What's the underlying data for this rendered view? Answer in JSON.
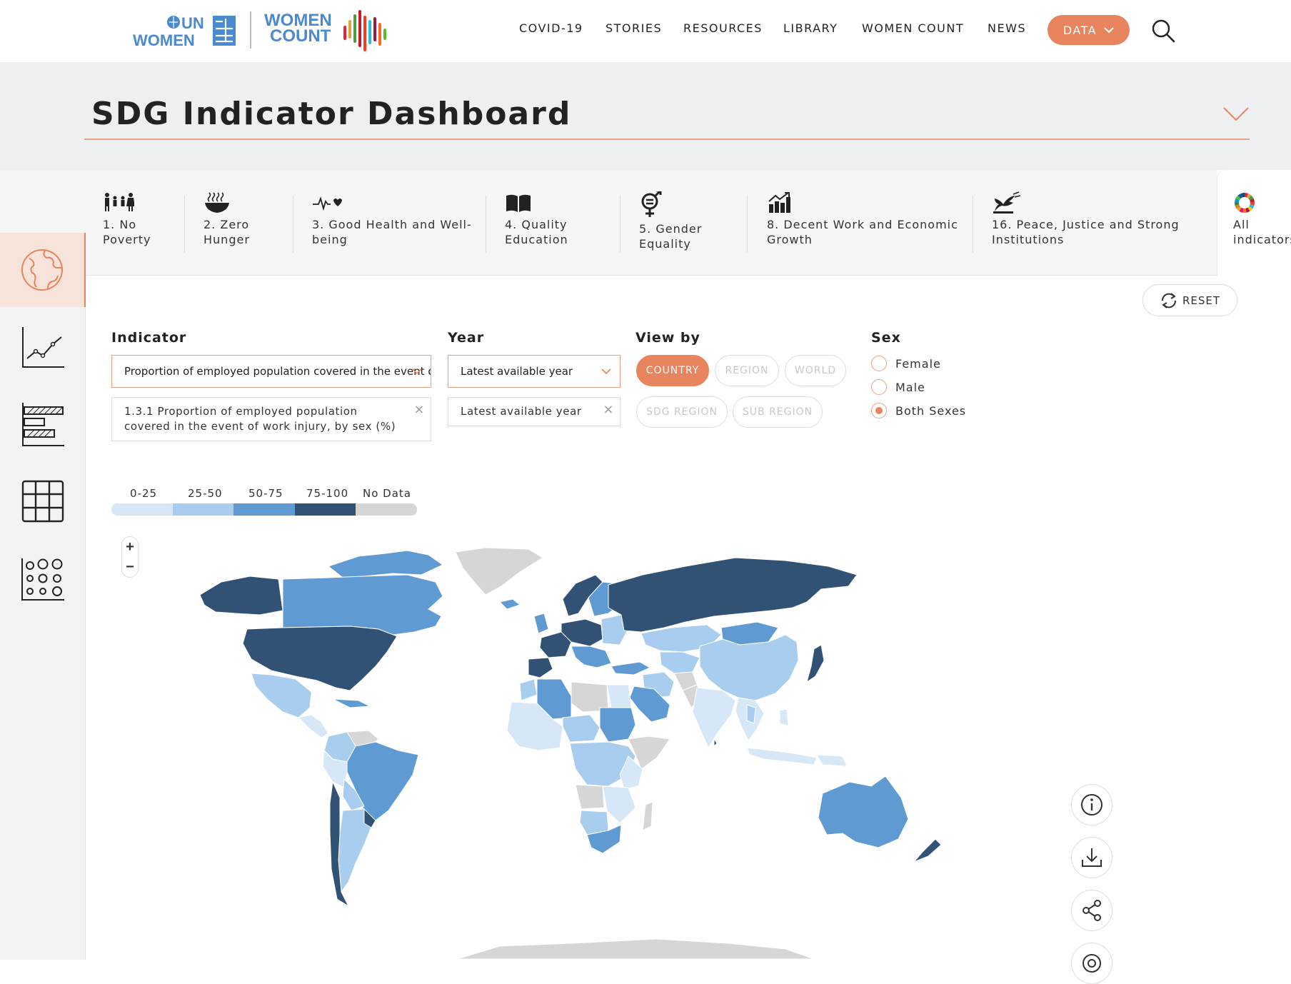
{
  "header": {
    "logo1_text": "UN WOMEN",
    "logo2_text": "WOMEN COUNT",
    "nav": [
      "COVID-19",
      "STORIES",
      "RESOURCES",
      "LIBRARY",
      "WOMEN COUNT",
      "NEWS"
    ],
    "data_button": "DATA"
  },
  "page_title": "SDG Indicator Dashboard",
  "goals": [
    {
      "line1": "1. No",
      "line2": "Poverty",
      "icon": "family-icon"
    },
    {
      "line1": "2. Zero",
      "line2": "Hunger",
      "icon": "bowl-icon"
    },
    {
      "line1": "3. Good Health and Well-",
      "line2": "being",
      "icon": "heartbeat-icon"
    },
    {
      "line1": "4. Quality",
      "line2": "Education",
      "icon": "book-icon"
    },
    {
      "line1": "5. Gender",
      "line2": "Equality",
      "icon": "gender-icon"
    },
    {
      "line1": "8. Decent Work and Economic",
      "line2": "Growth",
      "icon": "growth-chart-icon"
    },
    {
      "line1": "16. Peace, Justice and Strong",
      "line2": "Institutions",
      "icon": "dove-icon"
    }
  ],
  "all_indicators": {
    "line1": "All",
    "line2": "indicators"
  },
  "sidebar": [
    "map-view",
    "line-chart-view",
    "bar-chart-view",
    "table-view",
    "dot-grid-view"
  ],
  "reset_label": "RESET",
  "filters": {
    "indicator_label": "Indicator",
    "indicator_value": "Proportion of employed population covered in the event of work injury, by sex (%)",
    "indicator_tag_line1": "1.3.1 Proportion of employed population",
    "indicator_tag_line2": "covered in the event of work injury, by sex (%)",
    "year_label": "Year",
    "year_value": "Latest available year",
    "year_tag": "Latest available year",
    "viewby_label": "View by",
    "viewby_options": [
      "COUNTRY",
      "REGION",
      "WORLD",
      "SDG REGION",
      "SUB REGION"
    ],
    "viewby_selected": "COUNTRY",
    "sex_label": "Sex",
    "sex_options": [
      "Female",
      "Male",
      "Both Sexes"
    ],
    "sex_selected": "Both Sexes"
  },
  "legend": {
    "labels": [
      "0-25",
      "25-50",
      "50-75",
      "75-100",
      "No Data"
    ],
    "colors": [
      "#d6e8f7",
      "#a9cdee",
      "#5f9ad3",
      "#315274",
      "#d6d6d6"
    ]
  },
  "zoom": {
    "in": "+",
    "out": "−"
  },
  "actions": [
    "info-icon",
    "download-icon",
    "share-icon",
    "embed-icon"
  ],
  "colors": {
    "accent": "#e8845e",
    "nodata": "#d6d6d6"
  }
}
